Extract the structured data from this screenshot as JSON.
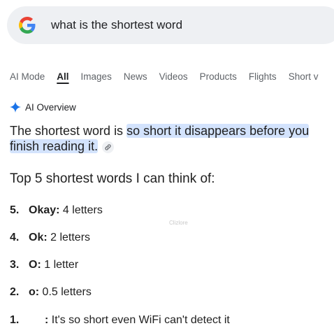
{
  "search": {
    "query": "what is the shortest word",
    "logo_icon": "google-g-icon"
  },
  "tabs": [
    {
      "label": "AI Mode",
      "active": false
    },
    {
      "label": "All",
      "active": true
    },
    {
      "label": "Images",
      "active": false
    },
    {
      "label": "News",
      "active": false
    },
    {
      "label": "Videos",
      "active": false
    },
    {
      "label": "Products",
      "active": false
    },
    {
      "label": "Flights",
      "active": false
    },
    {
      "label": "Short v",
      "active": false
    }
  ],
  "ai_overview": {
    "label": "AI Overview",
    "icon": "sparkle-icon",
    "accent_color": "#1a73e8",
    "answer_plain": "The shortest word is ",
    "answer_highlight": "so short it disappears before you finish reading it.",
    "highlight_color": "#d3e3fd",
    "link_icon": "link-icon"
  },
  "list": {
    "title": "Top 5 shortest words I can think of:",
    "items": [
      {
        "number": "5.",
        "term": "Okay",
        "sep": ":",
        "desc": " 4 letters"
      },
      {
        "number": "4.",
        "term": "Ok",
        "sep": ":",
        "desc": " 2 letters"
      },
      {
        "number": "3.",
        "term": "O",
        "sep": ":",
        "desc": " 1 letter"
      },
      {
        "number": "2.",
        "term": "o",
        "sep": ":",
        "desc": " 0.5 letters"
      },
      {
        "number": "1.",
        "term": "",
        "sep": ":",
        "desc": " It's so short even WiFi can't detect it"
      }
    ]
  },
  "watermark": "Clizlore"
}
